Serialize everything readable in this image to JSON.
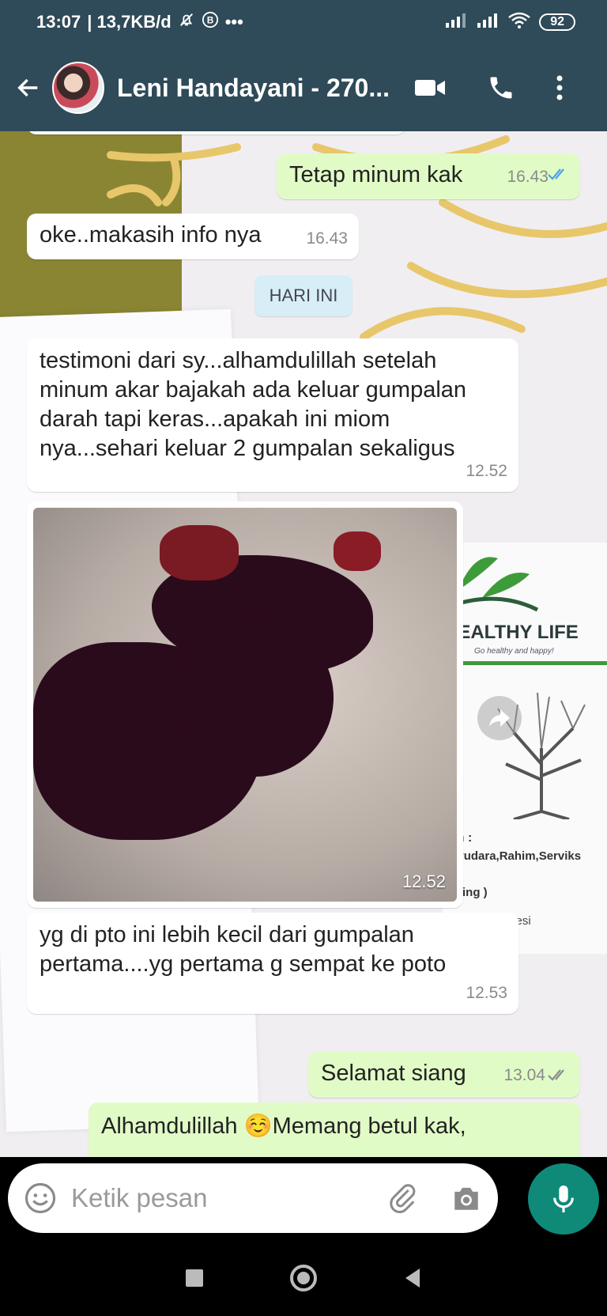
{
  "status": {
    "time": "13:07",
    "data_speed": "| 13,7KB/d",
    "battery": "92",
    "overflow": "•••"
  },
  "header": {
    "contact_name": "Leni Handayani - 270..."
  },
  "messages": [
    {
      "dir": "out",
      "text": "Tetap minum kak",
      "time": "16.43",
      "status": "read"
    },
    {
      "dir": "in",
      "text": "oke..makasih info nya",
      "time": "16.43"
    },
    {
      "dir": "in",
      "text": "testimoni dari sy...alhamdulillah setelah minum akar bajakah ada keluar gumpalan darah tapi keras...apakah ini miom nya...sehari keluar 2 gumpalan sekaligus",
      "time": "12.52"
    },
    {
      "dir": "in",
      "text": "yg di pto ini lebih kecil dari gumpalan pertama....yg pertama g sempat ke poto",
      "time": "12.53"
    },
    {
      "dir": "out",
      "text": "Selamat siang",
      "time": "13.04",
      "status": "delivered"
    },
    {
      "dir": "out",
      "text": "Alhamdulillah ☺️Memang betul kak,"
    }
  ],
  "date_divider": "HARI INI",
  "image_message": {
    "time": "12.52"
  },
  "wallpaper": {
    "brand": "HEALTHY LIFE",
    "tagline": "Go healthy and happy!",
    "fragments": [
      "kah :",
      "Payudara,Rahim,Serviks",
      "Kering )",
      "Depresi"
    ]
  },
  "input": {
    "placeholder": "Ketik pesan"
  },
  "colors": {
    "header": "#2f4a58",
    "outgoing_bubble": "#e1fbc6",
    "incoming_bubble": "#ffffff",
    "read_tick": "#4aa3e8",
    "mic_button": "#0f8a79"
  }
}
